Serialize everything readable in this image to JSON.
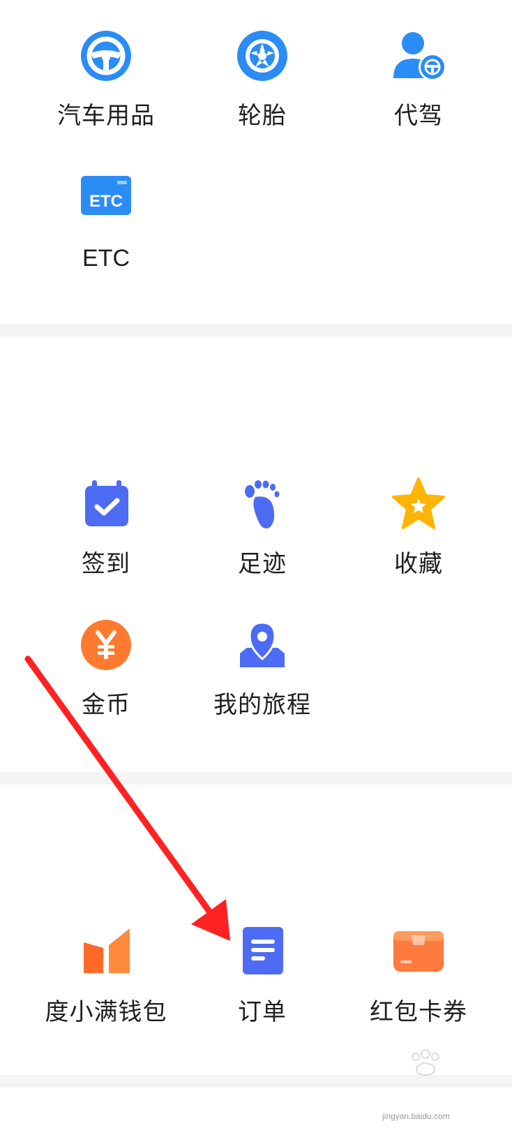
{
  "colors": {
    "blue": "#2b8cf5",
    "indigo": "#4d6cf3",
    "orange": "#ff7a2e",
    "yellow": "#ffb400",
    "divider": "#f4f4f5",
    "arrow": "#ff2222"
  },
  "section1": {
    "items": [
      {
        "label": "汽车用品",
        "icon": "steering-wheel-icon"
      },
      {
        "label": "轮胎",
        "icon": "tire-icon"
      },
      {
        "label": "代驾",
        "icon": "chauffeur-icon"
      },
      {
        "label": "ETC",
        "icon": "etc-card-icon"
      }
    ]
  },
  "section2": {
    "items": [
      {
        "label": "签到",
        "icon": "calendar-check-icon"
      },
      {
        "label": "足迹",
        "icon": "footprint-icon"
      },
      {
        "label": "收藏",
        "icon": "star-icon"
      },
      {
        "label": "金币",
        "icon": "yuan-coin-icon"
      },
      {
        "label": "我的旅程",
        "icon": "map-pin-icon"
      }
    ]
  },
  "section3": {
    "items": [
      {
        "label": "度小满钱包",
        "icon": "wallet-icon"
      },
      {
        "label": "订单",
        "icon": "order-document-icon"
      },
      {
        "label": "红包卡券",
        "icon": "coupon-card-icon"
      }
    ]
  },
  "watermark": {
    "text": "jingyan.baidu.com"
  }
}
